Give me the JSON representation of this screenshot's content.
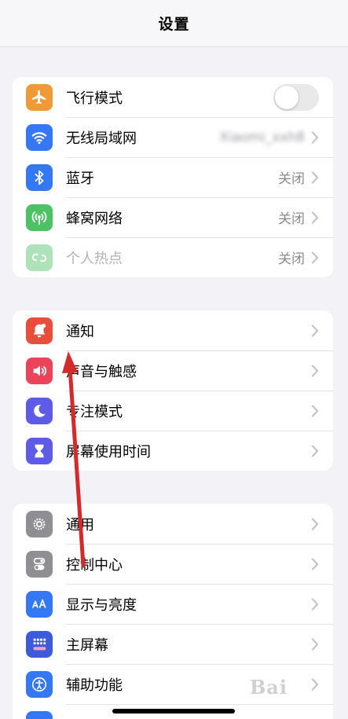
{
  "nav": {
    "title": "设置"
  },
  "group1": [
    {
      "label": "飞行模式",
      "type": "toggle",
      "on": false,
      "icon": "airplane-icon",
      "color": "#f09a37"
    },
    {
      "label": "无线局域网",
      "value": "Xiaomi_xxh8",
      "blurred": true,
      "icon": "wifi-icon",
      "color": "#3478f6"
    },
    {
      "label": "蓝牙",
      "value": "关闭",
      "icon": "bluetooth-icon",
      "color": "#3478f6"
    },
    {
      "label": "蜂窝网络",
      "value": "关闭",
      "icon": "antenna-icon",
      "color": "#4cc265"
    },
    {
      "label": "个人热点",
      "value": "关闭",
      "icon": "hotspot-link-icon",
      "color": "#4cc265",
      "dimmed": true
    }
  ],
  "group2": [
    {
      "label": "通知",
      "icon": "bell-icon",
      "color": "#eb4d3d"
    },
    {
      "label": "声音与触感",
      "icon": "speaker-icon",
      "color": "#eb445a"
    },
    {
      "label": "专注模式",
      "icon": "moon-icon",
      "color": "#5e5ce6"
    },
    {
      "label": "屏幕使用时间",
      "icon": "hourglass-icon",
      "color": "#5e5ce6"
    }
  ],
  "group3": [
    {
      "label": "通用",
      "icon": "gear-icon",
      "color": "#8e8e93"
    },
    {
      "label": "控制中心",
      "icon": "switches-icon",
      "color": "#8e8e93"
    },
    {
      "label": "显示与亮度",
      "icon": "text-size-icon",
      "color": "#3478f6"
    },
    {
      "label": "主屏幕",
      "icon": "home-grid-icon",
      "color": "#3b5bdb"
    },
    {
      "label": "辅助功能",
      "icon": "accessibility-icon",
      "color": "#3478f6"
    }
  ],
  "annotation": {
    "arrow_color": "#d42a2a"
  },
  "watermark": {
    "text": "Bai"
  }
}
